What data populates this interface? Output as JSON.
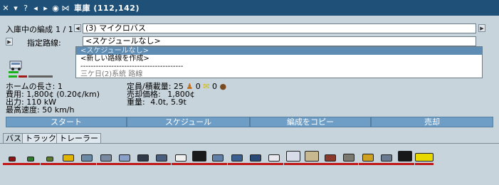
{
  "window": {
    "title": "車庫 (112,142)",
    "buttons": [
      "close-icon",
      "menu-icon",
      "help-icon",
      "prev-icon",
      "next-icon",
      "eye-icon",
      "pin-icon"
    ]
  },
  "depot": {
    "convoy_label": "入庫中の編成",
    "convoy_index": "1 / 1",
    "convoy_name": "(3) マイクロバス",
    "route_label": "指定路線:",
    "route_value": "<スケジュールなし>",
    "route_options": [
      {
        "label": "<スケジュールなし>",
        "selected": true
      },
      {
        "label": "<新しい路線を作成>",
        "selected": false
      },
      {
        "label": "----------------------------------------",
        "selected": false
      },
      {
        "label": "三ケ日(2)系統 路線",
        "selected": false
      }
    ]
  },
  "stats": {
    "left": [
      "ホームの長さ: 1",
      "費用:  1,800¢ (0.20¢/km)",
      "出力:  110 kW",
      "最高速度:  50 km/h"
    ],
    "capacity_label": "定員/積載量:",
    "capacity_value": "25",
    "capacity_mail": "0",
    "capacity_goods": "0",
    "price_label": "売却価格:",
    "price_value": "1,800¢",
    "weight_label": "重量:",
    "weight_value": "4.0t, 5.9t"
  },
  "actions": {
    "start": "スタート",
    "schedule": "スケジュール",
    "copy": "編成をコピー",
    "sell": "売却"
  },
  "tabs": [
    {
      "label": "バス",
      "active": true
    },
    {
      "label": "トラック",
      "active": false
    },
    {
      "label": "トレーラー",
      "active": false
    }
  ],
  "colors": {
    "titlebar": "#1f5178",
    "background": "#c8d4dc",
    "button": "#6e9ec6",
    "selected_row": "#5f8cb3",
    "vehicle_bar": "#c01616"
  },
  "vehicles": [
    {
      "icon": "moped-icon",
      "color": "#8a1414"
    },
    {
      "icon": "cart-icon",
      "color": "#2f7a2f"
    },
    {
      "icon": "cart-icon",
      "color": "#5a7a2a"
    },
    {
      "icon": "minibus-icon",
      "color": "#e0b400"
    },
    {
      "icon": "van-icon",
      "color": "#6a8aa8"
    },
    {
      "icon": "van-icon",
      "color": "#7a8aa0"
    },
    {
      "icon": "bus-icon",
      "color": "#8aa0c8"
    },
    {
      "icon": "bus-icon",
      "color": "#303a48"
    },
    {
      "icon": "bus-icon",
      "color": "#4a5e80"
    },
    {
      "icon": "bus-icon",
      "color": "#f0f0f0"
    },
    {
      "icon": "double-decker-icon",
      "color": "#1a1a1a"
    },
    {
      "icon": "bus-icon",
      "color": "#6080a8"
    },
    {
      "icon": "bus-icon",
      "color": "#3a6090"
    },
    {
      "icon": "bus-icon",
      "color": "#2a4a78"
    },
    {
      "icon": "bus-icon",
      "color": "#e8e8ee"
    },
    {
      "icon": "double-decker-icon",
      "color": "#d8dce8"
    },
    {
      "icon": "double-decker-icon",
      "color": "#c8b890"
    },
    {
      "icon": "bus-icon",
      "color": "#8a3a2a"
    },
    {
      "icon": "truck-icon",
      "color": "#7a7a70"
    },
    {
      "icon": "truck-icon",
      "color": "#d0a020"
    },
    {
      "icon": "van-icon",
      "color": "#6a7a90"
    },
    {
      "icon": "double-decker-icon",
      "color": "#181818"
    },
    {
      "icon": "articulated-bus-icon",
      "color": "#e8d800"
    }
  ]
}
